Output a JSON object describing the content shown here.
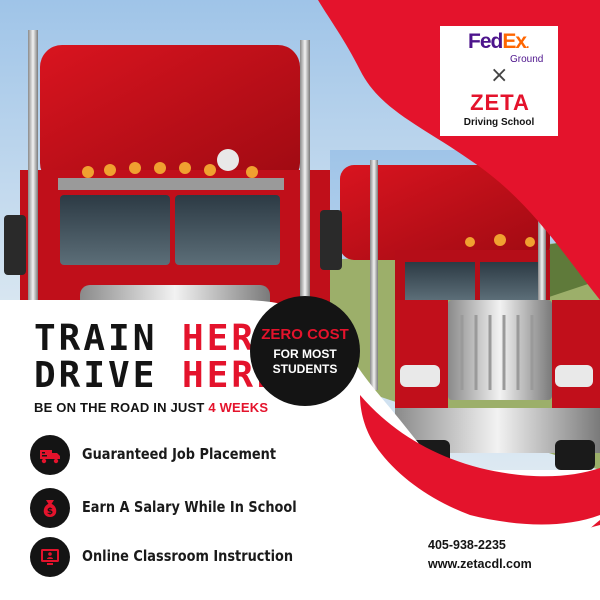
{
  "brand": {
    "fedex_fe": "Fed",
    "fedex_ex": "Ex",
    "fedex_dot": ".",
    "fedex_sub": "Ground",
    "cross": "×",
    "school_name": "ZETA",
    "school_sub": "Driving School"
  },
  "headline": {
    "line1_black": "TRAIN ",
    "line1_red": "HERE.",
    "line2_black": "DRIVE ",
    "line2_red": "HERE."
  },
  "subheadline": {
    "text": "BE ON THE ROAD IN JUST ",
    "highlight": "4 WEEKS"
  },
  "badge": {
    "line1": "ZERO COST",
    "line2": "FOR MOST",
    "line3": "STUDENTS"
  },
  "features": [
    {
      "label": "Guaranteed Job Placement",
      "icon": "truck-icon"
    },
    {
      "label": "Earn A Salary While In School",
      "icon": "money-bag-icon"
    },
    {
      "label": "Online Classroom Instruction",
      "icon": "online-class-icon"
    }
  ],
  "contact": {
    "phone": "405-938-2235",
    "website": "www.zetacdl.com"
  },
  "colors": {
    "brand_red": "#e4132c",
    "dark": "#141414",
    "fedex_purple": "#4d148c",
    "fedex_orange": "#ff6600"
  }
}
